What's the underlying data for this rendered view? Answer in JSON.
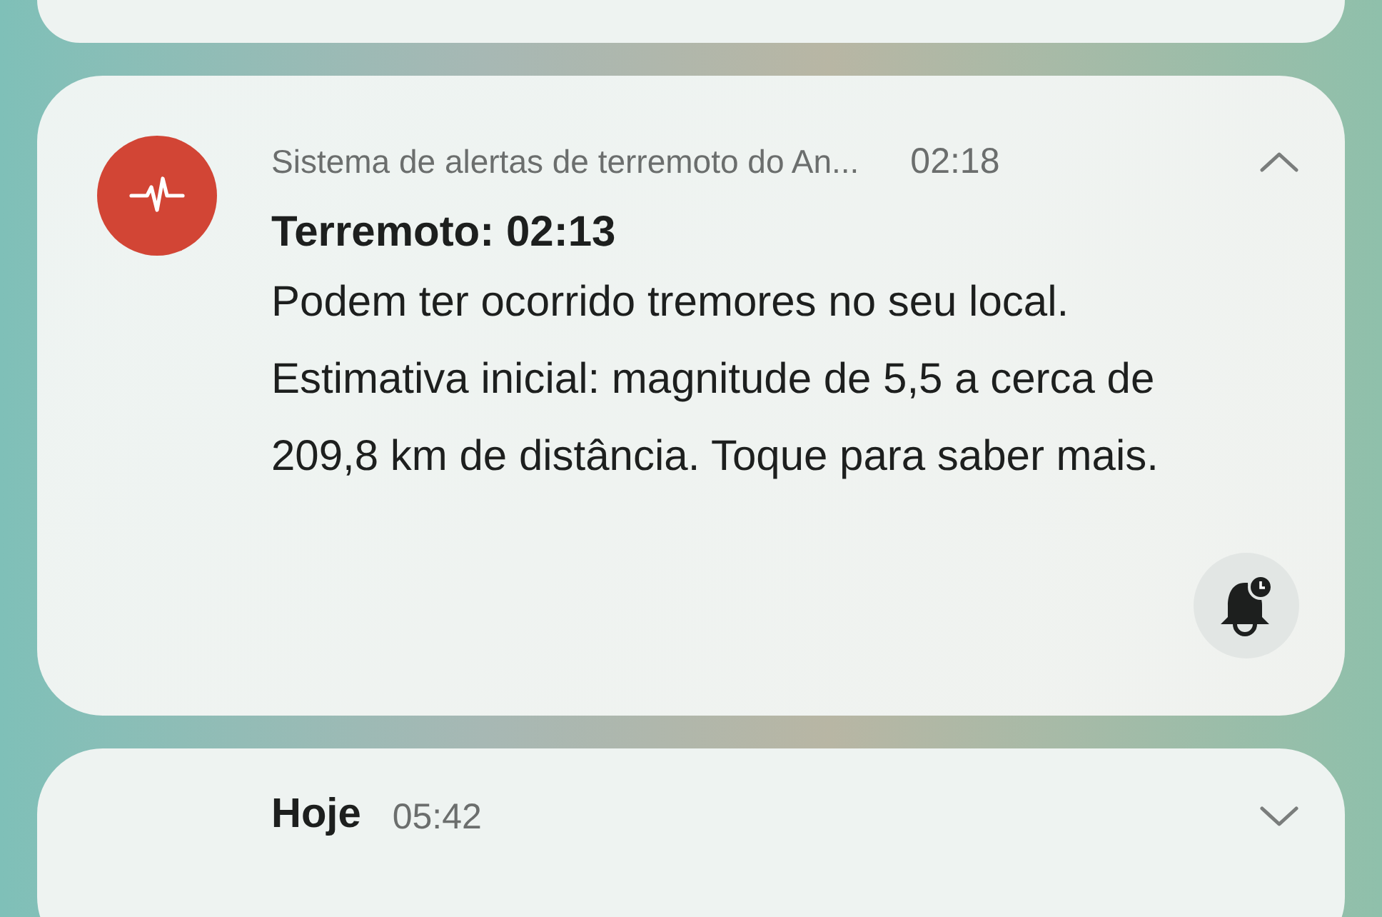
{
  "notifications": [
    {
      "kind": "partial_top"
    },
    {
      "kind": "alert",
      "app": "Sistema de alertas de terremoto do An...",
      "time": "02:18",
      "expanded": true,
      "title": "Terremoto: 02:13",
      "body": "Podem ter ocorrido tremores no seu local. Estimativa inicial: magnitude de 5,5 a cerca de 209,8 km de distância. Toque para saber mais."
    },
    {
      "kind": "summary",
      "title": "Hoje",
      "time": "05:42",
      "expanded": false
    }
  ]
}
